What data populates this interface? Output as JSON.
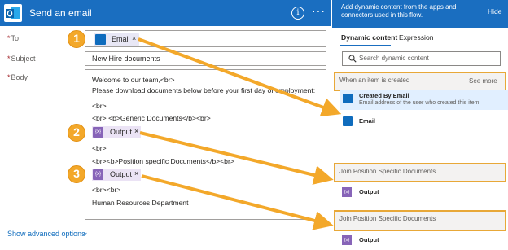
{
  "card": {
    "title": "Send an email",
    "info_glyph": "i",
    "more_glyph": "···",
    "fields": {
      "to_label": "To",
      "subject_label": "Subject",
      "body_label": "Body",
      "required_mark": "*"
    },
    "to_token": {
      "label": "Email",
      "remove_glyph": "×"
    },
    "subject_value": "New Hire documents",
    "body_lines": [
      "Welcome to our team,<br>",
      "Please download documents below before your first day of employment:",
      "<br>",
      "<br> <b>Generic Documents</b><br>",
      "<br>",
      "<br><b>Position specific Documents</b><br>",
      "<br><br>",
      "Human Resources Department"
    ],
    "output_tokens": [
      {
        "label": "Output",
        "remove_glyph": "×",
        "icon_glyph": "{x}"
      },
      {
        "label": "Output",
        "remove_glyph": "×",
        "icon_glyph": "{x}"
      }
    ],
    "show_advanced": "Show advanced options",
    "chevron_glyph": "⌄"
  },
  "panel": {
    "description": "Add dynamic content from the apps and connectors used in this flow.",
    "hide_label": "Hide",
    "tabs": [
      "Dynamic content",
      "Expression"
    ],
    "search_placeholder": "Search dynamic content",
    "sections": [
      {
        "title": "When an item is created",
        "see_more": "See more",
        "items": [
          {
            "title": "Created By Email",
            "description": "Email address of the user who created this item."
          },
          {
            "title": "Email"
          }
        ]
      },
      {
        "title": "Join Position Specific Documents",
        "items": [
          {
            "title": "Output"
          }
        ]
      },
      {
        "title": "Join Position Specific Documents",
        "items": [
          {
            "title": "Output"
          }
        ]
      }
    ]
  },
  "callouts": [
    "1",
    "2",
    "3"
  ],
  "colors": {
    "header_blue": "#1a6ec0",
    "callout_orange": "#f3a82a",
    "token_purple": "#8764b8",
    "outlook_blue": "#0f6cbd"
  },
  "icons": {
    "outlook": "outlook-icon",
    "info": "info-icon",
    "more": "more-icon",
    "search": "search-icon",
    "variable": "variable-icon"
  }
}
